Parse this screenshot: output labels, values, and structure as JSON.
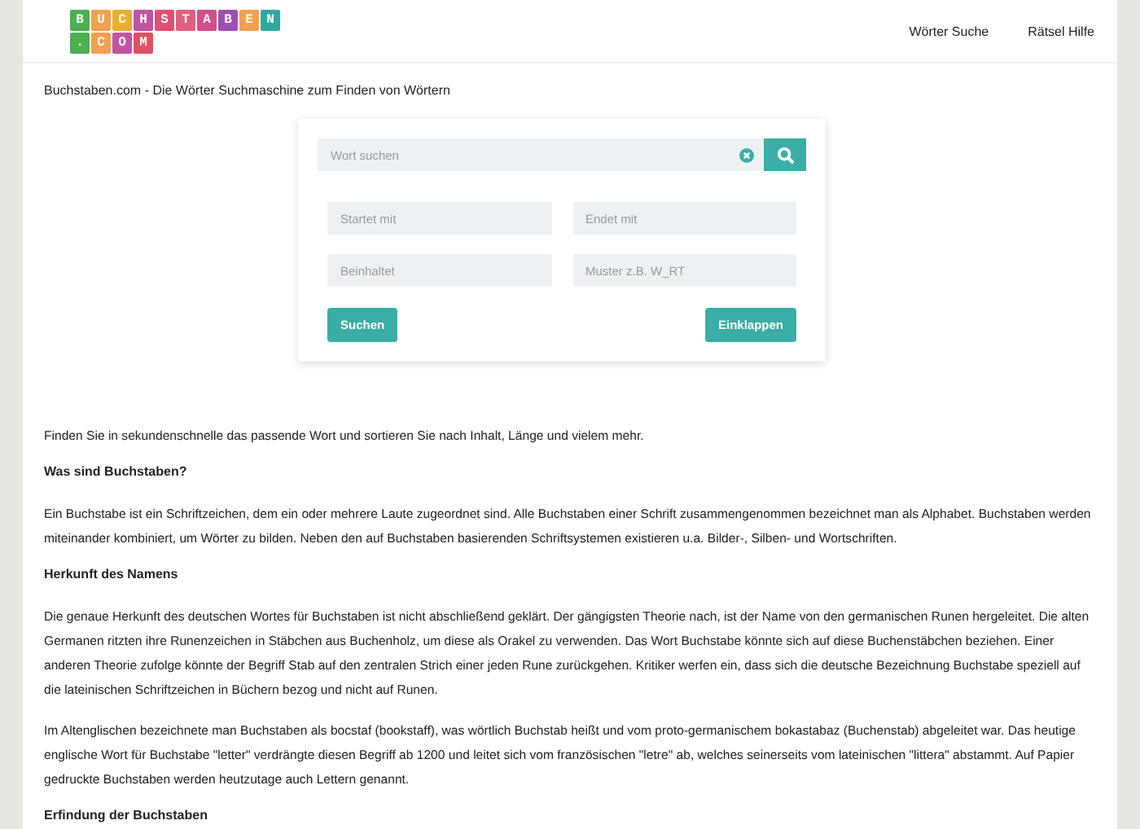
{
  "logo": {
    "rows": [
      [
        {
          "char": "B",
          "color": "#4caf50"
        },
        {
          "char": "U",
          "color": "#f0a050"
        },
        {
          "char": "C",
          "color": "#e8b030"
        },
        {
          "char": "H",
          "color": "#c055a0"
        },
        {
          "char": "S",
          "color": "#e05070"
        },
        {
          "char": "T",
          "color": "#e06080"
        },
        {
          "char": "A",
          "color": "#d0508a"
        },
        {
          "char": "B",
          "color": "#a050b0"
        },
        {
          "char": "E",
          "color": "#f0a050"
        },
        {
          "char": "N",
          "color": "#30a8a0"
        }
      ],
      [
        {
          "char": ".",
          "color": "#4caf50"
        },
        {
          "char": "C",
          "color": "#f0a050"
        },
        {
          "char": "O",
          "color": "#c055a0"
        },
        {
          "char": "M",
          "color": "#e05060"
        }
      ]
    ]
  },
  "nav": [
    {
      "label": "Wörter Suche"
    },
    {
      "label": "Rätsel Hilfe"
    }
  ],
  "subtitle": "Buchstaben.com - Die Wörter Suchmaschine zum Finden von Wörtern",
  "search": {
    "placeholder": "Wort suchen"
  },
  "filters": [
    {
      "placeholder": "Startet mit"
    },
    {
      "placeholder": "Endet mit"
    },
    {
      "placeholder": "Beinhaltet"
    },
    {
      "placeholder": "Muster z.B. W_RT"
    }
  ],
  "buttons": [
    "Suchen",
    "Einklappen"
  ],
  "content": [
    {
      "kind": "paragraph",
      "text": "Finden Sie in sekundenschnelle das passende Wort und sortieren Sie nach Inhalt, Länge und vielem mehr."
    },
    {
      "kind": "heading",
      "text": "Was sind Buchstaben?"
    },
    {
      "kind": "paragraph",
      "text": "Ein Buchstabe ist ein Schriftzeichen, dem ein oder mehrere Laute zugeordnet sind. Alle Buchstaben einer Schrift zusammengenommen bezeichnet man als Alphabet. Buchstaben werden miteinander kombiniert, um Wörter zu bilden. Neben den auf Buchstaben basierenden Schriftsystemen existieren u.a. Bilder-, Silben- und Wortschriften."
    },
    {
      "kind": "heading",
      "text": "Herkunft des Namens"
    },
    {
      "kind": "paragraph",
      "text": "Die genaue Herkunft des deutschen Wortes für Buchstaben ist nicht abschließend geklärt. Der gängigsten Theorie nach, ist der Name von den germanischen Runen hergeleitet. Die alten Germanen ritzten ihre Runenzeichen in Stäbchen aus Buchenholz, um diese als Orakel zu verwenden. Das Wort Buchstabe könnte sich auf diese Buchenstäbchen beziehen. Einer anderen Theorie zufolge könnte der Begriff Stab auf den zentralen Strich einer jeden Rune zurückgehen. Kritiker werfen ein, dass sich die deutsche Bezeichnung Buchstabe speziell auf die lateinischen Schriftzeichen in Büchern bezog und nicht auf Runen."
    },
    {
      "kind": "paragraph",
      "text": "Im Altenglischen bezeichnete man Buchstaben als bocstaf (bookstaff), was wörtlich Buchstab heißt und vom proto-germanischem bokastabaz (Buchenstab) abgeleitet war. Das heutige englische Wort für Buchstabe \"letter\" verdrängte diesen Begriff ab 1200 und leitet sich vom französischen \"letre\" ab, welches seinerseits vom lateinischen \"littera\" abstammt. Auf Papier gedruckte Buchstaben werden heutzutage auch Lettern genannt."
    },
    {
      "kind": "heading",
      "text": "Erfindung der Buchstaben"
    }
  ]
}
